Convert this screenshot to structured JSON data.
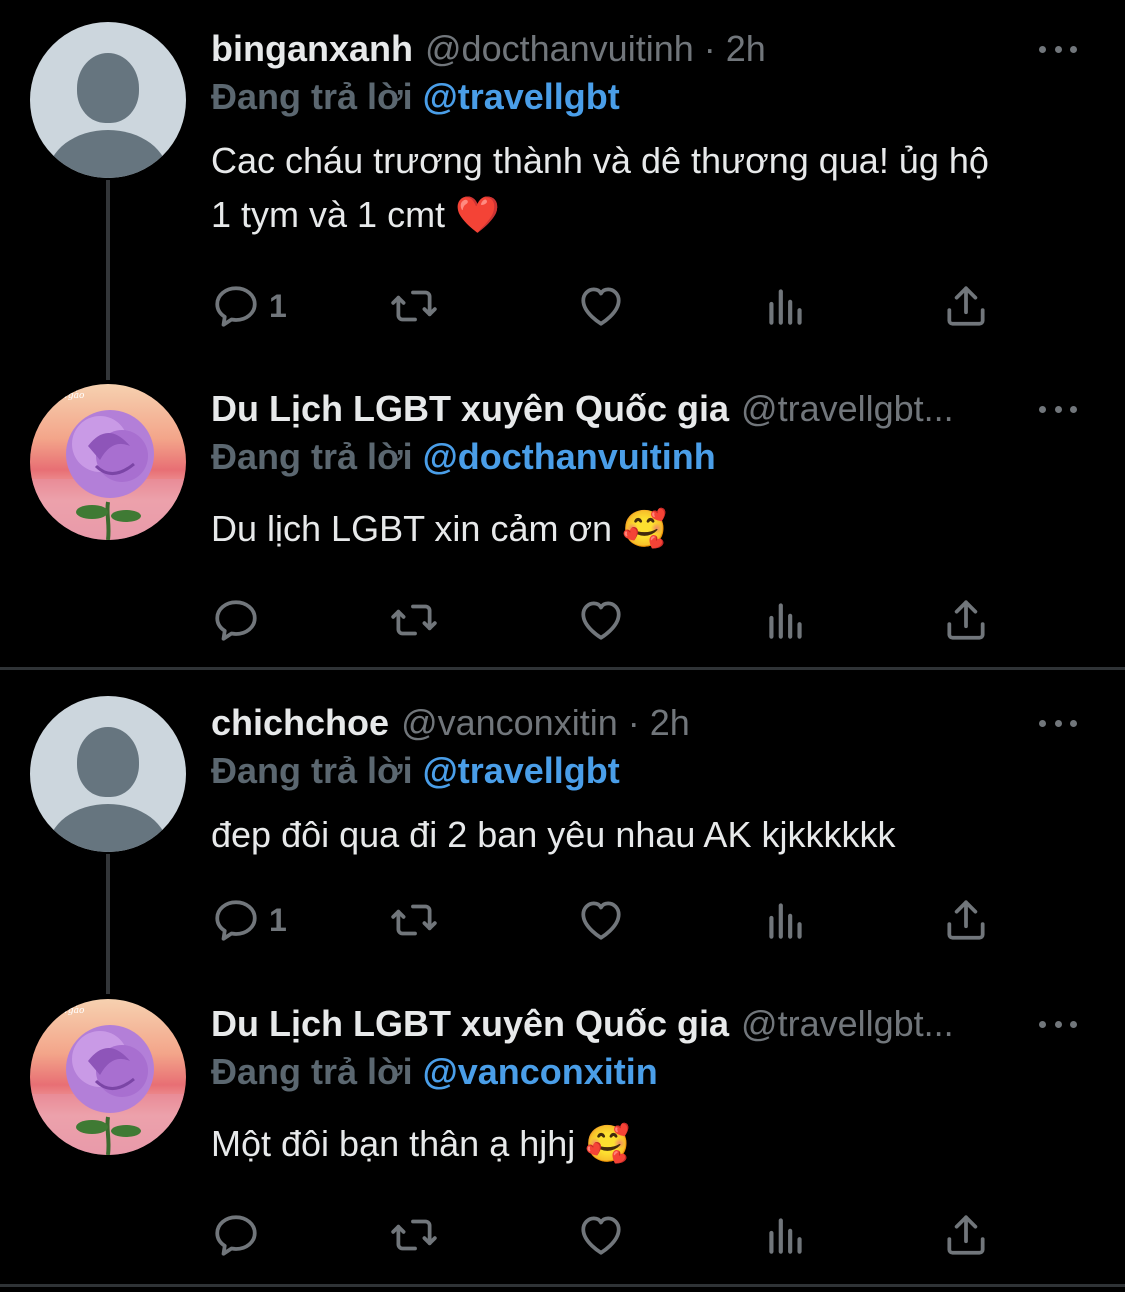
{
  "tweets": [
    {
      "name": "binganxanh",
      "handle": "@docthanvuitinh",
      "dot": "·",
      "time": "2h",
      "replying_label": "Đang trả lời",
      "replying_to": "@travellgbt",
      "text_line1": "Cac cháu trương thành và dê thương qua! ủg hộ",
      "text_line2": "1 tym và 1 cmt ❤️",
      "reply_count": "1",
      "avatar": "default-profile-avatar"
    },
    {
      "name": "Du Lịch LGBT xuyên Quốc gia",
      "handle": "@travellgbt...",
      "replying_label": "Đang trả lời",
      "replying_to": "@docthanvuitinh",
      "text_line1": "Du lịch LGBT xin cảm ơn 🥰",
      "reply_count": "",
      "avatar": "rose-avatar"
    },
    {
      "name": "chichchoe",
      "handle": "@vanconxitin",
      "dot": "·",
      "time": "2h",
      "replying_label": "Đang trả lời",
      "replying_to": "@travellgbt",
      "text_line1": "đep đôi qua đi 2 ban yêu nhau AK kjkkkkkk",
      "reply_count": "1",
      "avatar": "default-profile-avatar"
    },
    {
      "name": "Du Lịch LGBT xuyên Quốc gia",
      "handle": "@travellgbt...",
      "replying_label": "Đang trả lời",
      "replying_to": "@vanconxitin",
      "text_line1": "Một đôi bạn thân ạ hjhj 🥰",
      "reply_count": "",
      "avatar": "rose-avatar"
    }
  ],
  "icons": [
    "reply-icon",
    "retweet-icon",
    "like-icon",
    "views-icon",
    "share-icon",
    "more-icon"
  ],
  "colors": {
    "background": "#000000",
    "text": "#e7e9ea",
    "muted": "#71767b",
    "mention": "#4a9ee8",
    "divider": "#2f3336"
  }
}
